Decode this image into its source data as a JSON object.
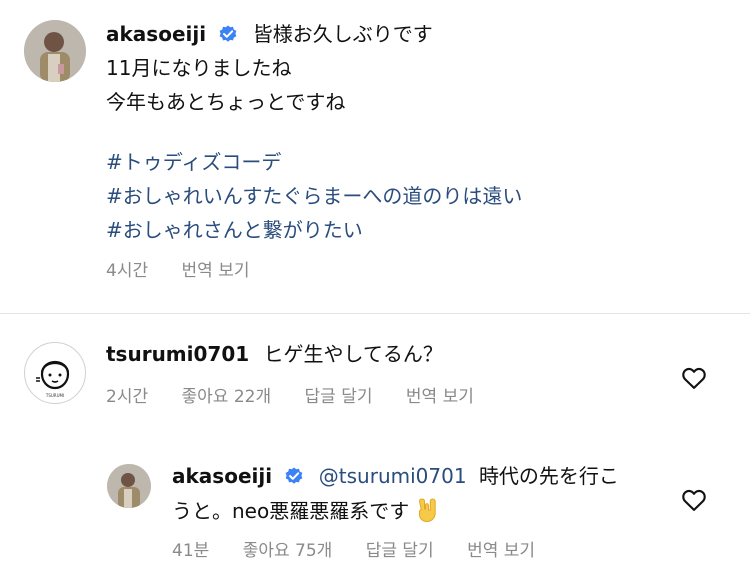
{
  "post": {
    "username": "akasoeiji",
    "lines": [
      "皆様お久しぶりです",
      "11月になりましたね",
      "今年もあとちょっとですね"
    ],
    "hashtags": [
      "#トゥディズコーデ",
      "#おしゃれいんすたぐらまーへの道のりは遠い",
      "#おしゃれさんと繋がりたい"
    ],
    "time": "4시간",
    "translate": "번역 보기"
  },
  "comment1": {
    "username": "tsurumi0701",
    "text": "ヒゲ生やしてるん？",
    "time": "2시간",
    "likes": "좋아요 22개",
    "reply": "답글 달기",
    "translate": "번역 보기",
    "avatar_text": "TSURUMI"
  },
  "reply1": {
    "username": "akasoeiji",
    "mention": "@tsurumi0701",
    "text_line1": "時代の先を行こ",
    "text_line2": "うと。neo悪羅悪羅系です",
    "emoji": "🤟",
    "time": "41분",
    "likes": "좋아요 75개",
    "reply": "답글 달기",
    "translate": "번역 보기"
  },
  "colors": {
    "hashtag": "#2a4d7d",
    "verified": "#3b82f6",
    "meta": "#8a8a8a"
  },
  "icons": {
    "verified": "verified-badge-icon",
    "heart": "heart-outline-icon"
  }
}
